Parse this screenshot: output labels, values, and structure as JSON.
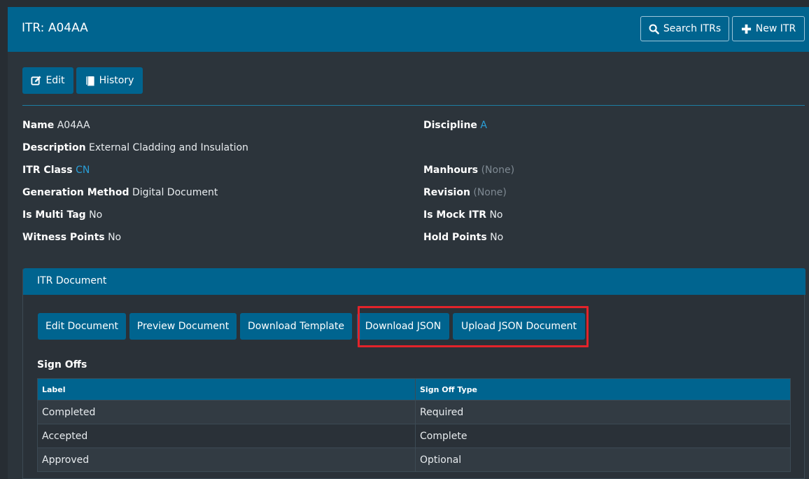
{
  "header": {
    "title": "ITR: A04AA",
    "search_label": "Search ITRs",
    "new_label": "New ITR"
  },
  "toolbar": {
    "edit_label": "Edit",
    "history_label": "History"
  },
  "details": {
    "name": {
      "label": "Name",
      "value": "A04AA"
    },
    "discipline": {
      "label": "Discipline",
      "value": "A"
    },
    "description": {
      "label": "Description",
      "value": "External Cladding and Insulation"
    },
    "itr_class": {
      "label": "ITR Class",
      "value": "CN"
    },
    "manhours": {
      "label": "Manhours",
      "value": "(None)"
    },
    "generation_method": {
      "label": "Generation Method",
      "value": "Digital Document"
    },
    "revision": {
      "label": "Revision",
      "value": "(None)"
    },
    "is_multi_tag": {
      "label": "Is Multi Tag",
      "value": "No"
    },
    "is_mock_itr": {
      "label": "Is Mock ITR",
      "value": "No"
    },
    "witness_points": {
      "label": "Witness Points",
      "value": "No"
    },
    "hold_points": {
      "label": "Hold Points",
      "value": "No"
    }
  },
  "itr_document": {
    "title": "ITR Document",
    "buttons": {
      "edit_document": "Edit Document",
      "preview_document": "Preview Document",
      "download_template": "Download Template",
      "download_json": "Download JSON",
      "upload_json": "Upload JSON Document"
    },
    "sign_offs_title": "Sign Offs",
    "table": {
      "columns": [
        "Label",
        "Sign Off Type"
      ],
      "rows": [
        [
          "Completed",
          "Required"
        ],
        [
          "Accepted",
          "Complete"
        ],
        [
          "Approved",
          "Optional"
        ]
      ]
    }
  },
  "colors": {
    "brand": "#00648f",
    "background": "#272d33",
    "link": "#2a9fd8",
    "highlight": "#e3232a"
  },
  "icons": {
    "search": "search-icon",
    "plus": "plus-icon",
    "edit": "edit-icon",
    "history": "book-icon"
  }
}
